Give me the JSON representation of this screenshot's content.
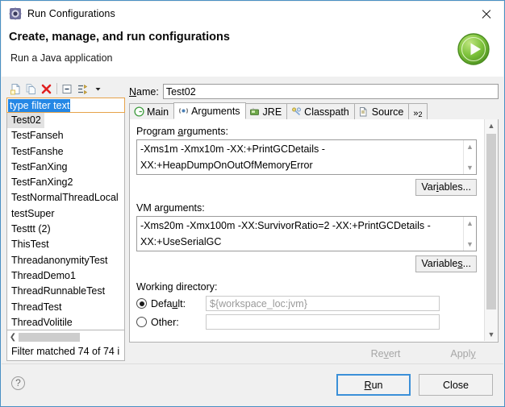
{
  "window": {
    "title": "Run Configurations",
    "app_icon": "eclipse-run-icon",
    "close_icon": "close-icon",
    "border_color": "#4a90c4"
  },
  "header": {
    "title": "Create, manage, and run configurations",
    "subtitle": "Run a Java application",
    "badge_icon": "run-green-play-icon",
    "badge_color": "#5fb32d"
  },
  "left_panel": {
    "toolbar": [
      {
        "name": "new-configuration-button",
        "icon": "new-document-icon"
      },
      {
        "name": "duplicate-configuration-button",
        "icon": "duplicate-document-icon"
      },
      {
        "name": "delete-configuration-button",
        "icon": "delete-red-x-icon"
      },
      {
        "name": "collapse-all-button",
        "icon": "collapse-all-icon"
      },
      {
        "name": "filter-configurations-button",
        "icon": "filter-arrows-icon"
      },
      {
        "name": "view-menu-button",
        "icon": "chevron-down-icon"
      }
    ],
    "filter": {
      "value": "type filter text",
      "placeholder": "type filter text",
      "selected": true
    },
    "items": [
      {
        "label": "Test02",
        "selected": true
      },
      {
        "label": "TestFanseh",
        "selected": false
      },
      {
        "label": "TestFanshe",
        "selected": false
      },
      {
        "label": "TestFanXing",
        "selected": false
      },
      {
        "label": "TestFanXing2",
        "selected": false
      },
      {
        "label": "TestNormalThreadLocal",
        "selected": false
      },
      {
        "label": "testSuper",
        "selected": false
      },
      {
        "label": "Testtt (2)",
        "selected": false
      },
      {
        "label": "ThisTest",
        "selected": false
      },
      {
        "label": "ThreadanonymityTest",
        "selected": false
      },
      {
        "label": "ThreadDemo1",
        "selected": false
      },
      {
        "label": "ThreadRunnableTest",
        "selected": false
      },
      {
        "label": "ThreadTest",
        "selected": false
      },
      {
        "label": "ThreadVolitile",
        "selected": false
      }
    ],
    "status": "Filter matched 74 of 74 i",
    "hscroll_left_icon": "chevron-left-icon"
  },
  "right_panel": {
    "name_label": "Name:",
    "name_label_mnemonic": "N",
    "name_value": "Test02",
    "tabs": [
      {
        "label": "Main",
        "icon": "main-tab-icon",
        "active": false
      },
      {
        "label": "Arguments",
        "icon": "arguments-tab-icon",
        "active": true
      },
      {
        "label": "JRE",
        "icon": "jre-tab-icon",
        "active": false
      },
      {
        "label": "Classpath",
        "icon": "classpath-tab-icon",
        "active": false
      },
      {
        "label": "Source",
        "icon": "source-tab-icon",
        "active": false
      }
    ],
    "tab_overflow": {
      "symbol": "»",
      "count": "2"
    },
    "program_arguments": {
      "label": "Program arguments:",
      "mnemonic": "a",
      "value": "-Xms1m -Xmx10m -XX:+PrintGCDetails -XX:+HeapDumpOnOutOfMemoryError",
      "variables_button": "Variables...",
      "variables_mnemonic": "i"
    },
    "vm_arguments": {
      "label": "VM arguments:",
      "value": "-Xms20m -Xmx100m -XX:SurvivorRatio=2 -XX:+PrintGCDetails -XX:+UseSerialGC",
      "variables_button": "Variables...",
      "variables_mnemonic": "s"
    },
    "working_directory": {
      "label": "Working directory:",
      "default_label": "Default:",
      "default_mnemonic": "u",
      "default_checked": true,
      "default_value": "${workspace_loc:jvm}",
      "other_label": "Other:",
      "other_checked": false
    },
    "revert_button": {
      "label": "Revert",
      "mnemonic": "v",
      "enabled": false
    },
    "apply_button": {
      "label": "Apply",
      "mnemonic": "y",
      "enabled": false
    }
  },
  "footer": {
    "help_icon": "help-question-icon",
    "help_symbol": "?",
    "run_button": {
      "label": "Run",
      "mnemonic": "R",
      "primary": true
    },
    "close_button": {
      "label": "Close"
    }
  }
}
